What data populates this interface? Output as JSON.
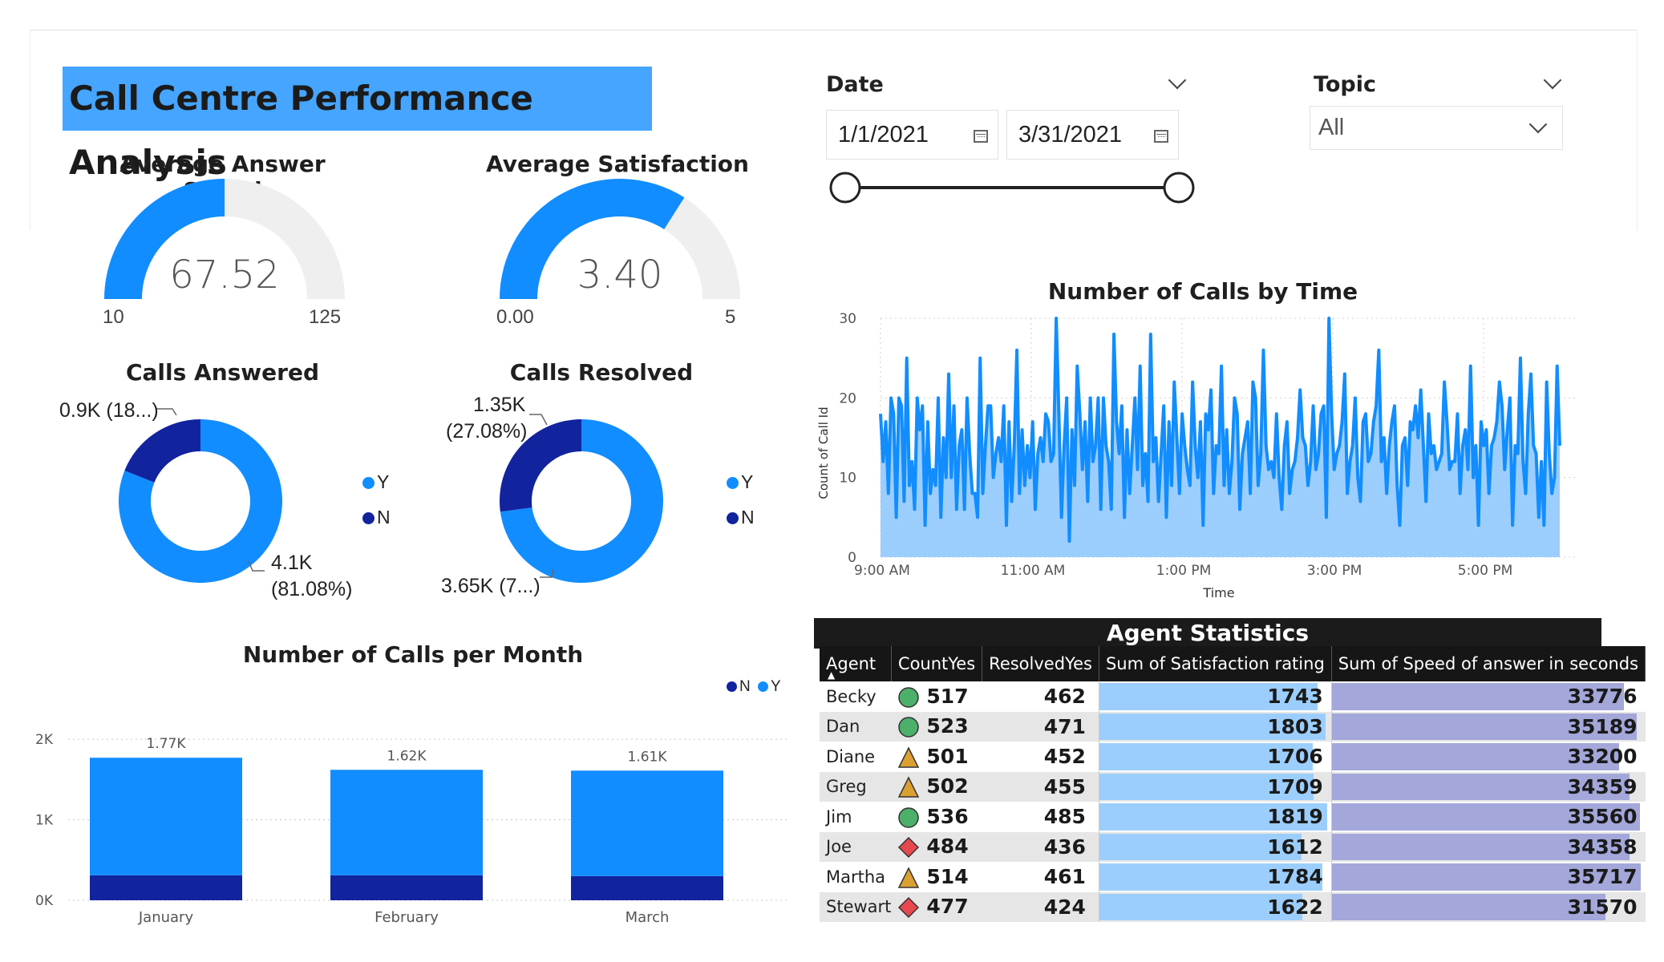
{
  "title": "Call Centre Performance Analysis",
  "gauges": [
    {
      "title": "Average Answer Speed",
      "value": "67.52",
      "min": "10",
      "max": "125",
      "fraction": 0.5002
    },
    {
      "title": "Average Satisfaction",
      "value": "3.40",
      "min": "0.00",
      "max": "5",
      "fraction": 0.68
    }
  ],
  "donuts": [
    {
      "title": "Calls Answered",
      "label_n": "0.9K (18...)",
      "label_y_1": "4.1K",
      "label_y_2": "(81.08%)",
      "y_pct": 81.08,
      "legend": [
        "Y",
        "N"
      ]
    },
    {
      "title": "Calls Resolved",
      "label_n_1": "1.35K",
      "label_n_2": "(27.08%)",
      "label_y": "3.65K (7...)",
      "y_pct": 72.92,
      "legend": [
        "Y",
        "N"
      ]
    }
  ],
  "colors": {
    "y": "#118dff",
    "n": "#12239e",
    "light": "#9ccefd",
    "track": "#efefef",
    "sat_bar": "#9ccefd",
    "speed_bar": "#a3a7d9",
    "green": "#4caf6a",
    "orange": "#dba032",
    "red": "#e6484f"
  },
  "date_slicer": {
    "title": "Date",
    "start": "1/1/2021",
    "end": "3/31/2021"
  },
  "topic_slicer": {
    "title": "Topic",
    "value": "All"
  },
  "line_chart": {
    "title": "Number of Calls by Time",
    "ylabel": "Count of Call Id",
    "xlabel": "Time",
    "yticks": [
      "30",
      "20",
      "10",
      "0"
    ],
    "xticks": [
      "9:00 AM",
      "11:00 AM",
      "1:00 PM",
      "3:00 PM",
      "5:00 PM"
    ]
  },
  "month_chart": {
    "title": "Number of Calls per Month",
    "legend": [
      "N",
      "Y"
    ],
    "yticks": [
      "2K",
      "1K",
      "0K"
    ]
  },
  "agent_table": {
    "title": "Agent Statistics",
    "columns": [
      "Agent",
      "CountYes",
      "ResolvedYes",
      "Sum of Satisfaction rating",
      "Sum of Speed of answer in seconds"
    ],
    "rows": [
      {
        "agent": "Becky",
        "status": "green",
        "count_yes": "517",
        "resolved_yes": "462",
        "satisfaction": "1743",
        "speed": "33776"
      },
      {
        "agent": "Dan",
        "status": "green",
        "count_yes": "523",
        "resolved_yes": "471",
        "satisfaction": "1803",
        "speed": "35189"
      },
      {
        "agent": "Diane",
        "status": "orange",
        "count_yes": "501",
        "resolved_yes": "452",
        "satisfaction": "1706",
        "speed": "33200"
      },
      {
        "agent": "Greg",
        "status": "orange",
        "count_yes": "502",
        "resolved_yes": "455",
        "satisfaction": "1709",
        "speed": "34359"
      },
      {
        "agent": "Jim",
        "status": "green",
        "count_yes": "536",
        "resolved_yes": "485",
        "satisfaction": "1819",
        "speed": "35560"
      },
      {
        "agent": "Joe",
        "status": "red",
        "count_yes": "484",
        "resolved_yes": "436",
        "satisfaction": "1612",
        "speed": "34358"
      },
      {
        "agent": "Martha",
        "status": "orange",
        "count_yes": "514",
        "resolved_yes": "461",
        "satisfaction": "1784",
        "speed": "35717"
      },
      {
        "agent": "Stewart",
        "status": "red",
        "count_yes": "477",
        "resolved_yes": "424",
        "satisfaction": "1622",
        "speed": "31570"
      }
    ]
  },
  "chart_data": [
    {
      "type": "area",
      "title": "Number of Calls by Time",
      "xlabel": "Time",
      "ylabel": "Count of Call Id",
      "x_range": [
        "9:00 AM",
        "5:59 PM"
      ],
      "ylim": [
        0,
        30
      ],
      "y": [
        18,
        12,
        17,
        8,
        20,
        18,
        5,
        20,
        19,
        7,
        25,
        9,
        12,
        6,
        20,
        16,
        19,
        4,
        17,
        8,
        11,
        9,
        20,
        5,
        15,
        10,
        23,
        10,
        19,
        6,
        14,
        16,
        6,
        20,
        13,
        8,
        8,
        5,
        25,
        8,
        14,
        19,
        19,
        10,
        13,
        15,
        12,
        19,
        4,
        17,
        7,
        14,
        26,
        8,
        16,
        9,
        14,
        10,
        17,
        6,
        13,
        15,
        12,
        18,
        17,
        12,
        13,
        30,
        18,
        5,
        14,
        20,
        2,
        16,
        9,
        24,
        18,
        11,
        17,
        7,
        20,
        12,
        14,
        20,
        6,
        20,
        14,
        12,
        6,
        28,
        17,
        13,
        19,
        5,
        16,
        8,
        14,
        20,
        11,
        24,
        9,
        13,
        7,
        28,
        12,
        15,
        7,
        13,
        19,
        5,
        17,
        9,
        22,
        15,
        8,
        18,
        14,
        11,
        9,
        22,
        14,
        10,
        17,
        4,
        18,
        16,
        21,
        8,
        14,
        13,
        24,
        9,
        16,
        8,
        12,
        20,
        18,
        6,
        13,
        15,
        17,
        8,
        22,
        20,
        9,
        13,
        26,
        14,
        11,
        12,
        10,
        18,
        10,
        6,
        14,
        17,
        8,
        11,
        12,
        15,
        21,
        15,
        14,
        9,
        12,
        19,
        11,
        13,
        18,
        19,
        5,
        30,
        18,
        11,
        13,
        14,
        17,
        23,
        8,
        12,
        14,
        20,
        10,
        7,
        17,
        18,
        12,
        13,
        17,
        19,
        26,
        12,
        15,
        8,
        14,
        17,
        19,
        9,
        4,
        14,
        15,
        9,
        17,
        16,
        19,
        15,
        21,
        14,
        7,
        18,
        13,
        14,
        11,
        12,
        13,
        22,
        17,
        11,
        12,
        12,
        18,
        8,
        14,
        16,
        11,
        24,
        10,
        14,
        4,
        17,
        14,
        16,
        8,
        14,
        15,
        17,
        22,
        19,
        11,
        16,
        20,
        4,
        14,
        13,
        25,
        12,
        8,
        18,
        23,
        14,
        13,
        5,
        12,
        4,
        22,
        13,
        8,
        10,
        24,
        14
      ]
    },
    {
      "type": "bar",
      "title": "Number of Calls per Month",
      "categories": [
        "January",
        "February",
        "March"
      ],
      "series": [
        {
          "name": "N",
          "values": [
            0.31,
            0.31,
            0.3
          ]
        },
        {
          "name": "Y",
          "values": [
            1.46,
            1.31,
            1.31
          ]
        }
      ],
      "totals": [
        "1.77K",
        "1.62K",
        "1.61K"
      ],
      "ylim": [
        0,
        2.2
      ],
      "ytick_unit": "K"
    }
  ]
}
